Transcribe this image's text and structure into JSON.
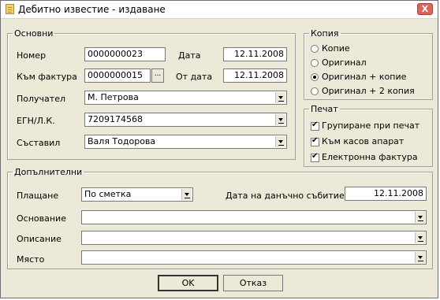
{
  "window": {
    "title": "Дебитно известие - издаване",
    "close_label": "X"
  },
  "osnovni": {
    "legend": "Основни",
    "nomer_label": "Номер",
    "nomer_value": "0000000023",
    "data_label": "Дата",
    "data_value": "12.11.2008",
    "kam_faktura_label": "Към фактура",
    "kam_faktura_value": "0000000015",
    "ellipsis_label": "...",
    "ot_data_label": "От дата",
    "ot_data_value": "12.11.2008",
    "poluchatel_label": "Получател",
    "poluchatel_value": "М. Петрова",
    "egn_label": "ЕГН/Л.К.",
    "egn_value": "7209174568",
    "sastavil_label": "Съставил",
    "sastavil_value": "Валя Тодорова"
  },
  "kopiya": {
    "legend": "Копия",
    "options": [
      {
        "label": "Копие",
        "selected": false
      },
      {
        "label": "Оригинал",
        "selected": false
      },
      {
        "label": "Оригинал + копие",
        "selected": true
      },
      {
        "label": "Оригинал + 2 копия",
        "selected": false
      }
    ]
  },
  "pechat": {
    "legend": "Печат",
    "options": [
      {
        "label": "Групиране при печат",
        "checked": true
      },
      {
        "label": "Към касов апарат",
        "checked": true
      },
      {
        "label": "Електронна фактура",
        "checked": true
      }
    ]
  },
  "dopalnitelni": {
    "legend": "Допълнителни",
    "plashtane_label": "Плащане",
    "plashtane_value": "По сметка",
    "danachno_label": "Дата на данъчно събитие",
    "danachno_value": "12.11.2008",
    "osnovanie_label": "Основание",
    "osnovanie_value": "",
    "opisanie_label": "Описание",
    "opisanie_value": "",
    "myasto_label": "Място",
    "myasto_value": ""
  },
  "buttons": {
    "ok_label": "OK",
    "cancel_label": "Отказ"
  }
}
